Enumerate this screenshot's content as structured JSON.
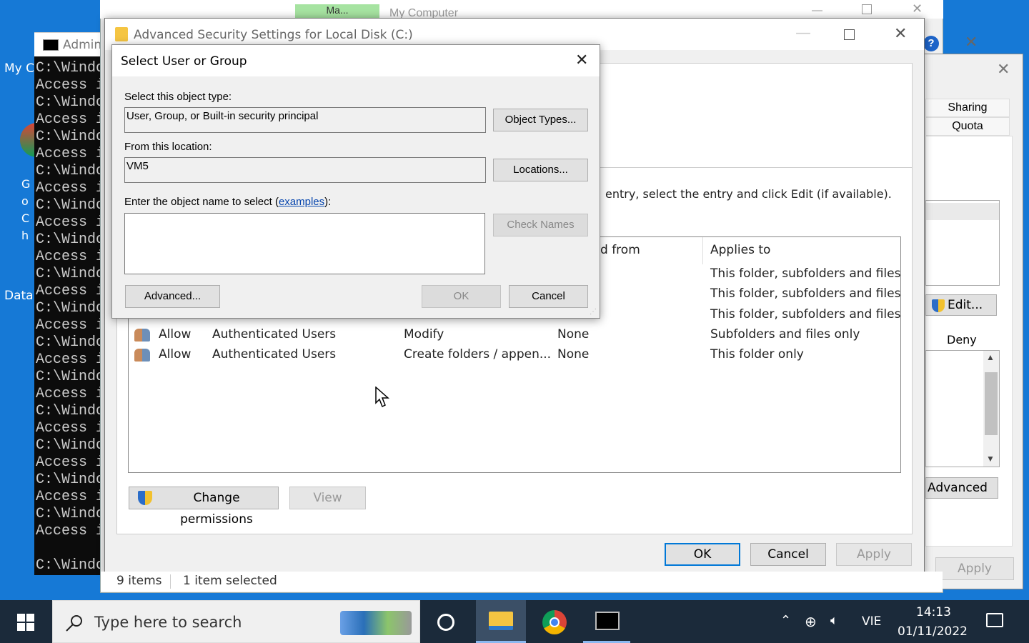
{
  "desktop": {
    "icons": [
      {
        "label": "My C"
      },
      {
        "label": "Go Ch"
      },
      {
        "label": "Data"
      }
    ]
  },
  "cmd": {
    "title": "Admin",
    "lines": [
      "C:\\Windo",
      "Access i",
      "C:\\Windo",
      "Access i",
      "C:\\Windo",
      "Access i",
      "C:\\Windo",
      "Access i",
      "C:\\Windo",
      "Access i",
      "C:\\Windo",
      "Access i",
      "C:\\Windo",
      "Access i",
      "C:\\Windo",
      "Access i",
      "C:\\Windo",
      "Access i",
      "C:\\Windo",
      "Access i",
      "C:\\Windo",
      "Access i",
      "C:\\Windo",
      "Access i",
      "C:\\Windo",
      "Access i",
      "C:\\Windo",
      "Access i",
      "",
      "C:\\Windo"
    ]
  },
  "explorer": {
    "tab_label": "Ma...",
    "title": "My Computer",
    "status_items": "9 items",
    "status_selected": "1 item selected"
  },
  "props": {
    "tab_sharing": "Sharing",
    "tab_quota": "Quota",
    "edit_label": "Edit...",
    "deny_label": "Deny",
    "advanced_label": "Advanced",
    "apply_label": "Apply"
  },
  "adv": {
    "title": "Advanced Security Settings for Local Disk (C:)",
    "instructions": "entry, select the entry and click Edit (if available).",
    "columns": {
      "inherited": "d from",
      "applies": "Applies to"
    },
    "rows": [
      {
        "type": "",
        "principal": "",
        "access": "",
        "inherited": "",
        "applies": "This folder, subfolders and files"
      },
      {
        "type": "",
        "principal": "",
        "access": "",
        "inherited": "",
        "applies": "This folder, subfolders and files"
      },
      {
        "type": "",
        "principal": "",
        "access": "",
        "inherited": "",
        "applies": "This folder, subfolders and files"
      },
      {
        "type": "Allow",
        "principal": "Authenticated Users",
        "access": "Modify",
        "inherited": "None",
        "applies": "Subfolders and files only"
      },
      {
        "type": "Allow",
        "principal": "Authenticated Users",
        "access": "Create folders / appen...",
        "inherited": "None",
        "applies": "This folder only"
      }
    ],
    "change_permissions": "Change permissions",
    "view": "View",
    "ok": "OK",
    "cancel": "Cancel",
    "apply": "Apply"
  },
  "select_dialog": {
    "title": "Select User or Group",
    "object_type_label": "Select this object type:",
    "object_type_value": "User, Group, or Built-in security principal",
    "object_types_button": "Object Types...",
    "location_label": "From this location:",
    "location_value": "VM5",
    "locations_button": "Locations...",
    "enter_label_prefix": "Enter the object name to select (",
    "examples_link": "examples",
    "enter_label_suffix": "):",
    "object_name_value": "",
    "check_names_button": "Check Names",
    "advanced_button": "Advanced...",
    "ok_button": "OK",
    "cancel_button": "Cancel"
  },
  "taskbar": {
    "search_placeholder": "Type here to search",
    "language": "VIE",
    "time": "14:13",
    "date": "01/11/2022"
  }
}
